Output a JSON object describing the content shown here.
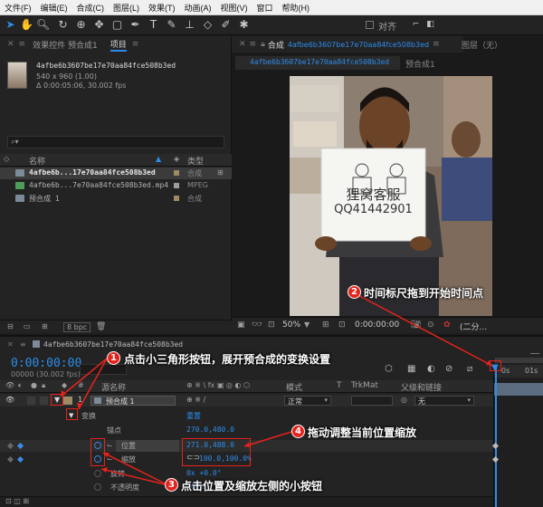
{
  "menu": [
    "文件(F)",
    "编辑(E)",
    "合成(C)",
    "图层(L)",
    "效果(T)",
    "动画(A)",
    "视图(V)",
    "窗口",
    "帮助(H)"
  ],
  "toolbar": {
    "snap_label": "对齐"
  },
  "project": {
    "tab_effects": "效果控件 预合成1",
    "tab_project": "项目",
    "item_name": "4afbe6b3607be17e70aa84fce508b3ed",
    "item_dims": "540 x 960 (1.00)",
    "item_duration": "Δ 0:00:05:06, 30.002 fps",
    "col_name": "名称",
    "col_type": "类型",
    "rows": [
      {
        "name": "4afbe6b...17e70aa84fce508b3ed",
        "type": "合成"
      },
      {
        "name": "4afbe6b...7e70aa84fce508b3ed.mp4",
        "type": "MPEG"
      },
      {
        "name": "预合成 1",
        "type": "合成"
      }
    ],
    "bpc": "8 bpc"
  },
  "comp": {
    "tab_label": "合成",
    "tab_name": "4afbe6b3607be17e70aa84fce508b3ed",
    "subtab1": "4afbe6b3607be17e70aa84fce508b3ed",
    "subtab2": "预合成1",
    "layer_panel": "图层（无）",
    "sign_line1": "狸窝客服",
    "sign_line2": "QQ41442901",
    "zoom": "50%",
    "timecode": "0:00:00:00",
    "resolution": "(二分..."
  },
  "timeline": {
    "tab": "4afbe6b3607be17e70aa84fce508b3ed",
    "timecode": "0:00:00:00",
    "fps": "00000 (30.002 fps)",
    "col_src": "源名称",
    "col_mode": "模式",
    "col_t": "T",
    "col_trkmat": "TrkMat",
    "col_parent": "父级和链接",
    "layer_num": "1",
    "layer_name": "预合成 1",
    "mode_value": "正常",
    "parent_value": "无",
    "transform": "变换",
    "reset": "重置",
    "props": [
      {
        "name": "锚点",
        "value": "270.0,480.0"
      },
      {
        "name": "位置",
        "value": "271.0,488.0"
      },
      {
        "name": "缩放",
        "value": "100.0,100.0%"
      },
      {
        "name": "旋转",
        "value": "0x +0.0°"
      },
      {
        "name": "不透明度",
        "value": "100%"
      }
    ],
    "ruler_0": "0s",
    "ruler_1": "01s"
  },
  "annotations": {
    "a1": "点击小三角形按钮，展开预合成的变换设置",
    "a2": "时间标尺拖到开始时间点",
    "a3": "点击位置及缩放左侧的小按钮",
    "a4": "拖动调整当前位置缩放",
    "n1": "1",
    "n2": "2",
    "n3": "3",
    "n4": "4"
  }
}
